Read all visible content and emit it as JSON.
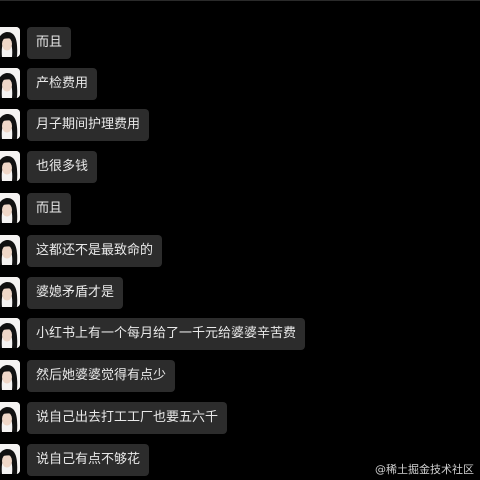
{
  "theme": {
    "background": "#000000",
    "bubble_background": "#2c2c2c",
    "bubble_text": "#e9e9e9",
    "avatar_background": "#f5f3f2",
    "avatar_hair": "#111111"
  },
  "messages": [
    {
      "text": "而且"
    },
    {
      "text": "产检费用"
    },
    {
      "text": "月子期间护理费用"
    },
    {
      "text": "也很多钱"
    },
    {
      "text": "而且"
    },
    {
      "text": "这都还不是最致命的"
    },
    {
      "text": "婆媳矛盾才是"
    },
    {
      "text": "小红书上有一个每月给了一千元给婆婆辛苦费"
    },
    {
      "text": "然后她婆婆觉得有点少"
    },
    {
      "text": "说自己出去打工工厂也要五六千"
    },
    {
      "text": "说自己有点不够花"
    }
  ],
  "watermark": {
    "text": "@稀土掘金技术社区"
  }
}
